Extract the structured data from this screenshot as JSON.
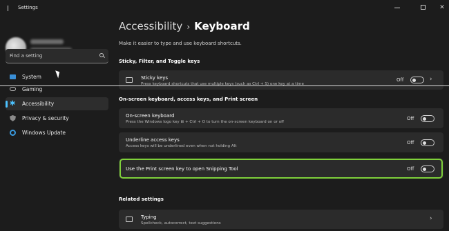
{
  "window": {
    "title": "Settings"
  },
  "sidebar": {
    "search_placeholder": "Find a setting",
    "items": [
      {
        "label": "System",
        "icon": "system-icon"
      },
      {
        "label": "Gaming",
        "icon": "gaming-icon"
      },
      {
        "label": "Accessibility",
        "icon": "accessibility-icon",
        "selected": true
      },
      {
        "label": "Privacy & security",
        "icon": "shield-icon"
      },
      {
        "label": "Windows Update",
        "icon": "update-icon"
      }
    ]
  },
  "main": {
    "breadcrumb": {
      "parent": "Accessibility",
      "separator": "›",
      "current": "Keyboard"
    },
    "description": "Make it easier to type and use keyboard shortcuts.",
    "sections": [
      {
        "title": "Sticky, Filter, and Toggle keys",
        "cards": [
          {
            "title": "Sticky keys",
            "desc": "Press keyboard shortcuts that use multiple keys (such as Ctrl + S) one key at a time",
            "state": "Off"
          }
        ]
      },
      {
        "title": "On-screen keyboard, access keys, and Print screen",
        "cards": [
          {
            "title": "On-screen keyboard",
            "desc": "Press the Windows logo key ⊞ + Ctrl + O to turn the on-screen keyboard on or off",
            "state": "Off"
          },
          {
            "title": "Underline access keys",
            "desc": "Access keys will be underlined even when not holding Alt",
            "state": "Off"
          },
          {
            "title": "Use the Print screen key to open Snipping Tool",
            "state": "Off"
          }
        ]
      },
      {
        "title": "Related settings",
        "cards": [
          {
            "title": "Typing",
            "desc": "Spellcheck, autocorrect, text suggestions"
          }
        ]
      }
    ]
  },
  "colors": {
    "accent": "#4cc2ff",
    "highlight": "#7fd13b",
    "background": "#1c1c1c",
    "card": "#2b2b2b"
  }
}
